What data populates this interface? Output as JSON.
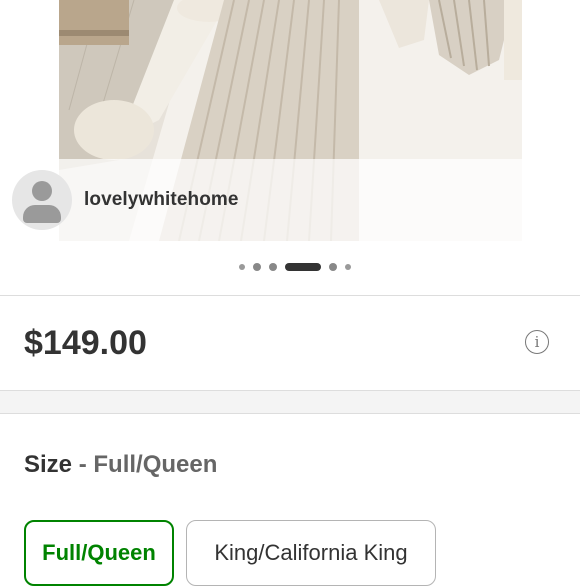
{
  "photo": {
    "description_icon": "bedroom-photo",
    "credit_username": "lovelywhitehome",
    "avatar_icon": "user-placeholder-icon"
  },
  "carousel": {
    "dot_count": 6,
    "active_index": 3
  },
  "product": {
    "price": "$149.00",
    "info_icon": "info-icon"
  },
  "size": {
    "label": "Size",
    "separator": "-",
    "selected_value": "Full/Queen",
    "options": [
      {
        "label": "Full/Queen",
        "selected": true
      },
      {
        "label": "King/California King",
        "selected": false
      }
    ]
  },
  "colors": {
    "accent_selected": "#008300",
    "text": "#333333"
  }
}
